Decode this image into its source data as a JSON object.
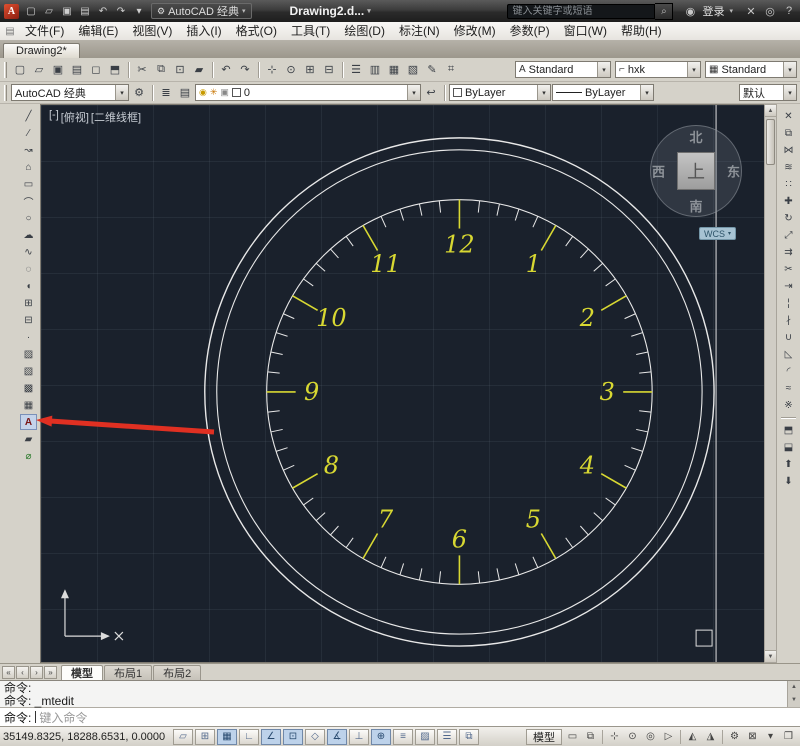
{
  "colors": {
    "arrow_red": "#e03022",
    "clock_yellow": "#d8d832",
    "clock_white": "#e8e8e8",
    "canvas_bg": "#1a212c"
  },
  "glyphs": {
    "caret": "▾",
    "caret_up": "▲",
    "caret_down": "▼",
    "search": "⌕",
    "gear": "⚙",
    "user": "◉",
    "doc": "▤",
    "x_mark": "✕"
  },
  "titlebar": {
    "logo_letter": "A",
    "qat_icons": [
      {
        "name": "qnew",
        "glyph": "▢"
      },
      {
        "name": "open",
        "glyph": "▱"
      },
      {
        "name": "save",
        "glyph": "▣"
      },
      {
        "name": "plot",
        "glyph": "▤"
      },
      {
        "name": "undo",
        "glyph": "↶"
      },
      {
        "name": "redo",
        "glyph": "↷"
      },
      {
        "name": "qat-menu",
        "glyph": "▾"
      }
    ],
    "workspace_label": "AutoCAD 经典",
    "doc_title": "Drawing2.d...",
    "search_placeholder": "键入关键字或短语",
    "signin_label": "登录",
    "right_icons": [
      {
        "name": "exchange-apps",
        "glyph": "✕"
      },
      {
        "name": "communication-center",
        "glyph": "◎"
      },
      {
        "name": "help",
        "glyph": "?"
      }
    ]
  },
  "menubar": {
    "items": [
      "文件(F)",
      "编辑(E)",
      "视图(V)",
      "插入(I)",
      "格式(O)",
      "工具(T)",
      "绘图(D)",
      "标注(N)",
      "修改(M)",
      "参数(P)",
      "窗口(W)",
      "帮助(H)"
    ]
  },
  "file_tab": {
    "label": "Drawing2*"
  },
  "toolbar1": {
    "icons": [
      {
        "name": "qnew",
        "glyph": "▢"
      },
      {
        "name": "open",
        "glyph": "▱"
      },
      {
        "name": "save",
        "glyph": "▣"
      },
      {
        "name": "plot",
        "glyph": "▤"
      },
      {
        "name": "plot-preview",
        "glyph": "◻"
      },
      {
        "name": "publish",
        "glyph": "⬒"
      },
      {
        "sep": true
      },
      {
        "name": "cut",
        "glyph": "✂"
      },
      {
        "name": "copy-clip",
        "glyph": "⧉"
      },
      {
        "name": "paste",
        "glyph": "⊡"
      },
      {
        "name": "match-properties",
        "glyph": "▰"
      },
      {
        "sep": true
      },
      {
        "name": "undo",
        "glyph": "↶"
      },
      {
        "name": "redo",
        "glyph": "↷"
      },
      {
        "sep": true
      },
      {
        "name": "pan",
        "glyph": "⊹"
      },
      {
        "name": "zoom-realtime",
        "glyph": "⊙"
      },
      {
        "name": "zoom-window",
        "glyph": "⊞"
      },
      {
        "name": "zoom-previous",
        "glyph": "⊟"
      },
      {
        "sep": true
      },
      {
        "name": "properties-palette",
        "glyph": "☰"
      },
      {
        "name": "designcenter",
        "glyph": "▥"
      },
      {
        "name": "tool-palettes",
        "glyph": "▦"
      },
      {
        "name": "sheet-set-manager",
        "glyph": "▧"
      },
      {
        "name": "markup",
        "glyph": "✎"
      },
      {
        "name": "quick-calc",
        "glyph": "⌗"
      }
    ],
    "style_combos": [
      {
        "icon": "A",
        "value": "Standard"
      },
      {
        "icon": "⌐",
        "value": "hxk"
      },
      {
        "icon": "▦",
        "value": "Standard"
      }
    ]
  },
  "toolbar2": {
    "workspace_value": "AutoCAD 经典",
    "layer_icons": [
      {
        "name": "layer-properties",
        "glyph": "≣"
      },
      {
        "name": "layer-states",
        "glyph": "▤"
      }
    ],
    "layer_combo": {
      "on": "◉",
      "freeze": "✳",
      "lock": "▣",
      "value": "0"
    },
    "post_icons": [
      {
        "name": "layer-previous",
        "glyph": "↩"
      }
    ],
    "color_value": "ByLayer",
    "linetype_value": "ByLayer",
    "default_label": "默认"
  },
  "left_toolbar": {
    "icons": [
      {
        "name": "line",
        "glyph": "╱"
      },
      {
        "name": "construction-line",
        "glyph": "∕"
      },
      {
        "name": "polyline",
        "glyph": "↝"
      },
      {
        "name": "polygon",
        "glyph": "⌂"
      },
      {
        "name": "rectangle",
        "glyph": "▭"
      },
      {
        "name": "arc",
        "glyph": "⌒"
      },
      {
        "name": "circle",
        "glyph": "○"
      },
      {
        "name": "revision-cloud",
        "glyph": "☁"
      },
      {
        "name": "spline",
        "glyph": "∿"
      },
      {
        "name": "ellipse",
        "glyph": "◌"
      },
      {
        "name": "ellipse-arc",
        "glyph": "◖"
      },
      {
        "name": "insert-block",
        "glyph": "⊞"
      },
      {
        "name": "make-block",
        "glyph": "⊟"
      },
      {
        "name": "point",
        "glyph": "·"
      },
      {
        "name": "hatch",
        "glyph": "▨"
      },
      {
        "name": "gradient",
        "glyph": "▧"
      },
      {
        "name": "region",
        "glyph": "▩"
      },
      {
        "name": "table",
        "glyph": "▦"
      },
      {
        "name": "multiline-text",
        "glyph": "A",
        "pressed": true,
        "color": "#7a1515"
      },
      {
        "name": "wipeout",
        "glyph": "▰"
      },
      {
        "name": "helix",
        "glyph": "⌀",
        "color": "#2a7a2a"
      }
    ]
  },
  "right_toolbar": {
    "icons": [
      {
        "name": "erase",
        "glyph": "✕"
      },
      {
        "name": "copy",
        "glyph": "⧉"
      },
      {
        "name": "mirror",
        "glyph": "⋈"
      },
      {
        "name": "offset",
        "glyph": "≋"
      },
      {
        "name": "array",
        "glyph": "∷"
      },
      {
        "name": "move",
        "glyph": "✚"
      },
      {
        "name": "rotate",
        "glyph": "↻"
      },
      {
        "name": "scale",
        "glyph": "⤢"
      },
      {
        "name": "stretch",
        "glyph": "⇉"
      },
      {
        "name": "trim",
        "glyph": "✂"
      },
      {
        "name": "extend",
        "glyph": "⇥"
      },
      {
        "name": "break-at-point",
        "glyph": "¦"
      },
      {
        "name": "break",
        "glyph": "∤"
      },
      {
        "name": "join",
        "glyph": "∪"
      },
      {
        "name": "chamfer",
        "glyph": "◺"
      },
      {
        "name": "fillet",
        "glyph": "◜"
      },
      {
        "name": "blend-curves",
        "glyph": "≈"
      },
      {
        "name": "explode",
        "glyph": "※"
      },
      {
        "sep": true
      },
      {
        "name": "bring-to-front",
        "glyph": "⬒"
      },
      {
        "name": "send-to-back",
        "glyph": "⬓"
      },
      {
        "name": "bring-above",
        "glyph": "⬆"
      },
      {
        "name": "send-below",
        "glyph": "⬇"
      }
    ]
  },
  "canvas": {
    "viewport_controls": {
      "minimize": "[-]",
      "view": "[俯视]",
      "visual_style": "[二维线框]"
    },
    "viewcube": {
      "north": "北",
      "south": "南",
      "west": "西",
      "east": "东",
      "top": "上",
      "wcs_label": "WCS"
    },
    "clock": {
      "numbers": [
        "1",
        "2",
        "3",
        "4",
        "5",
        "6",
        "7",
        "8",
        "9",
        "10",
        "11",
        "12"
      ]
    }
  },
  "layout_tabs": {
    "nav_icons": [
      {
        "name": "first-tab",
        "glyph": "«"
      },
      {
        "name": "prev-tab",
        "glyph": "‹"
      },
      {
        "name": "next-tab",
        "glyph": "›"
      },
      {
        "name": "last-tab",
        "glyph": "»"
      }
    ],
    "items": [
      "模型",
      "布局1",
      "布局2"
    ]
  },
  "command": {
    "history": [
      "命令:",
      "命令: _mtedit"
    ],
    "prompt": "命令:",
    "placeholder": "键入命令"
  },
  "statusbar": {
    "coordinates": "35149.8325, 18288.6531, 0.0000",
    "toggles": [
      {
        "name": "infer-constraints",
        "glyph": "▱"
      },
      {
        "name": "snap-mode",
        "glyph": "⊞"
      },
      {
        "name": "grid-display",
        "glyph": "▦",
        "pressed": true
      },
      {
        "name": "ortho-mode",
        "glyph": "∟"
      },
      {
        "name": "polar-tracking",
        "glyph": "∠",
        "pressed": true
      },
      {
        "name": "object-snap",
        "glyph": "⊡",
        "pressed": true
      },
      {
        "name": "3d-object-snap",
        "glyph": "◇"
      },
      {
        "name": "object-snap-tracking",
        "glyph": "∡",
        "pressed": true
      },
      {
        "name": "dynamic-ucs",
        "glyph": "⊥"
      },
      {
        "name": "dynamic-input",
        "glyph": "⊕",
        "pressed": true
      },
      {
        "name": "lineweight",
        "glyph": "≡"
      },
      {
        "name": "transparency",
        "glyph": "▨"
      },
      {
        "name": "quick-properties",
        "glyph": "☰"
      },
      {
        "name": "selection-cycling",
        "glyph": "⧉"
      }
    ],
    "model_label": "模型",
    "right_icons": [
      {
        "name": "quick-view-layouts",
        "glyph": "▭"
      },
      {
        "name": "quick-view-drawings",
        "glyph": "⧉"
      },
      {
        "sep": true
      },
      {
        "name": "pan",
        "glyph": "⊹"
      },
      {
        "name": "zoom",
        "glyph": "⊙"
      },
      {
        "name": "steering-wheel",
        "glyph": "◎"
      },
      {
        "name": "show-motion",
        "glyph": "▷"
      },
      {
        "sep": true
      },
      {
        "name": "annotation-visibility",
        "glyph": "◭"
      },
      {
        "name": "annotation-autoscale",
        "glyph": "◮"
      },
      {
        "sep": true
      },
      {
        "name": "workspace-switching",
        "glyph": "⚙"
      },
      {
        "name": "toolbar-lock",
        "glyph": "⊠"
      },
      {
        "name": "status-menu",
        "glyph": "▾"
      },
      {
        "name": "clean-screen",
        "glyph": "❒"
      }
    ]
  }
}
